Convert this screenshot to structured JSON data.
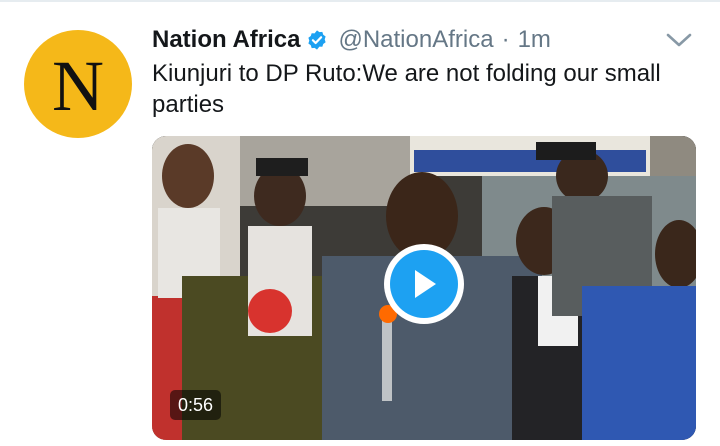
{
  "tweet": {
    "avatar_letter": "N",
    "display_name": "Nation Africa",
    "handle": "@NationAfrica",
    "separator": "·",
    "time": "1m",
    "text": "Kiunjuri to DP Ruto:We are not folding our small parties",
    "verified_icon": "verified-badge-icon",
    "menu_icon": "chevron-down-icon"
  },
  "media": {
    "type": "video",
    "duration": "0:56",
    "play_icon": "play-icon"
  },
  "colors": {
    "avatar_bg": "#f5b819",
    "accent": "#1da1f2",
    "muted_text": "#657786",
    "main_text": "#14171a"
  }
}
